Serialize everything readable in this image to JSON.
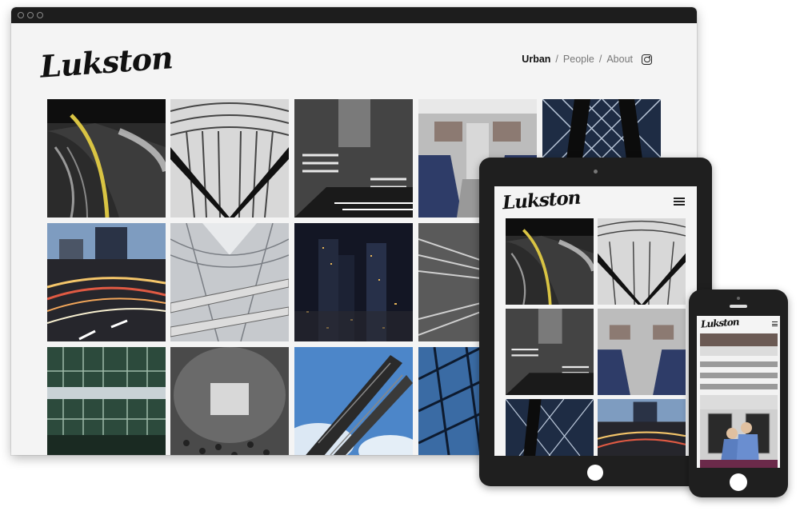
{
  "brand": {
    "logo_text": "Lukston"
  },
  "nav": {
    "items": [
      {
        "label": "Urban",
        "active": true
      },
      {
        "label": "People",
        "active": false
      },
      {
        "label": "About",
        "active": false
      }
    ],
    "separator": "/",
    "social_icon": "instagram-icon"
  },
  "gallery": {
    "photos": [
      {
        "subject": "railway-tracks"
      },
      {
        "subject": "steel-v-structure"
      },
      {
        "subject": "spiral-staircase"
      },
      {
        "subject": "train-interior"
      },
      {
        "subject": "glass-tower"
      },
      {
        "subject": "traffic-light-trails"
      },
      {
        "subject": "atrium-walkways"
      },
      {
        "subject": "night-cityscape"
      },
      {
        "subject": "motion-tunnel"
      },
      {
        "subject": "green-glass-building"
      },
      {
        "subject": "mirror-plaza"
      },
      {
        "subject": "sky-sculpture"
      },
      {
        "subject": "glass-facade-blue"
      }
    ]
  },
  "tablet": {
    "logo_text": "Lukston",
    "menu_icon": "hamburger-icon"
  },
  "phone": {
    "logo_text": "Lukston",
    "menu_icon": "hamburger-icon",
    "featured_subject": "crosswalk-police"
  },
  "colors": {
    "window_chrome": "#1d1d1d",
    "page_bg": "#f4f4f4",
    "nav_active": "#111111",
    "nav_inactive": "#777777",
    "device_body": "#1f1f1f"
  }
}
